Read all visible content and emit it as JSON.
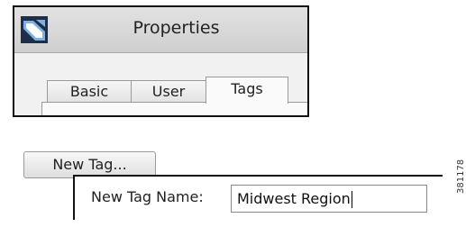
{
  "window": {
    "title": "Properties",
    "icon": "app-logo-icon",
    "tabs": [
      {
        "label": "Basic",
        "selected": false
      },
      {
        "label": "User",
        "selected": false
      },
      {
        "label": "Tags",
        "selected": true
      }
    ]
  },
  "new_tag_button": {
    "label": "New Tag..."
  },
  "new_tag_form": {
    "label": "New Tag Name:",
    "value": "Midwest Region"
  },
  "figure_number": "381178",
  "colors": {
    "icon_background": "#1d2e48",
    "icon_accent": "#7fb0e0",
    "border": "#111111"
  }
}
